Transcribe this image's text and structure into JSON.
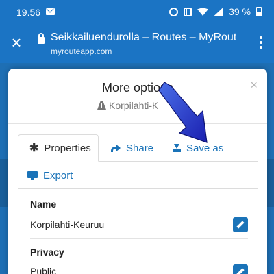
{
  "status_bar": {
    "time": "19.56",
    "battery_percent": "39 %"
  },
  "browser": {
    "close_symbol": "×",
    "title": "Seikkailuendurolla – Routes – MyRout",
    "url": "myrouteapp.com"
  },
  "modal": {
    "title": "More options",
    "subtitle": "Korpilahti-K",
    "close_symbol": "×",
    "tabs": [
      {
        "label": "Properties",
        "icon": "asterisk-icon",
        "active": true
      },
      {
        "label": "Share",
        "icon": "share-icon",
        "active": false
      },
      {
        "label": "Save as",
        "icon": "download-icon",
        "active": false
      },
      {
        "label": "Export",
        "icon": "monitor-icon",
        "active": false
      }
    ],
    "fields": [
      {
        "label": "Name",
        "value": "Korpilahti-Keuruu"
      },
      {
        "label": "Privacy",
        "value": "Public"
      }
    ]
  },
  "colors": {
    "brand_blue": "#1b74c4",
    "link_blue": "#1a73b8",
    "arrow_blue": "#1f2fc8"
  }
}
